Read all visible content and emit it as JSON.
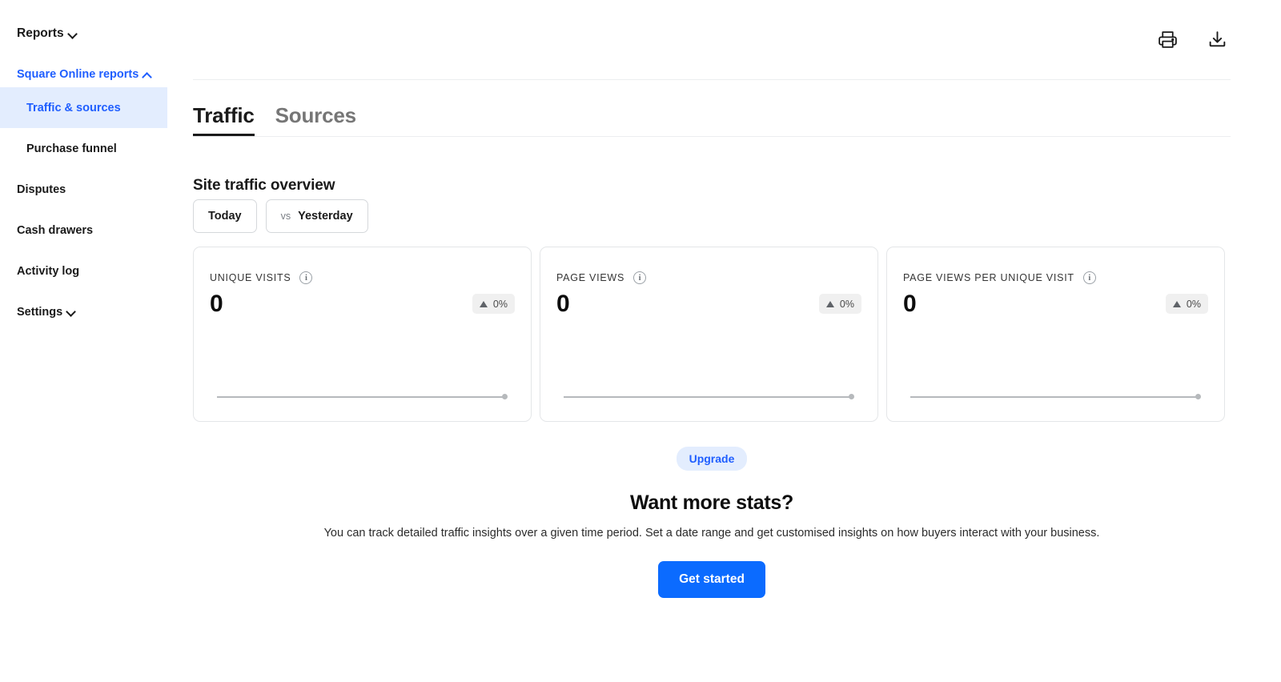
{
  "sidebar": {
    "top": {
      "label": "Reports",
      "icon": "chevron-down-icon"
    },
    "group": {
      "label": "Square Online reports",
      "icon": "chevron-up-icon"
    },
    "sub_items": [
      {
        "label": "Traffic & sources",
        "active": true
      },
      {
        "label": "Purchase funnel",
        "active": false
      }
    ],
    "items": [
      {
        "label": "Disputes",
        "has_chevron": false
      },
      {
        "label": "Cash drawers",
        "has_chevron": false
      },
      {
        "label": "Activity log",
        "has_chevron": false
      },
      {
        "label": "Settings",
        "has_chevron": true
      }
    ]
  },
  "topbar": {
    "print_icon": "printer-icon",
    "download_icon": "download-icon"
  },
  "tabs": [
    {
      "label": "Traffic",
      "active": true
    },
    {
      "label": "Sources",
      "active": false
    }
  ],
  "overview": {
    "title": "Site traffic overview",
    "range_primary": "Today",
    "range_vs_prefix": "vs",
    "range_compare": "Yesterday"
  },
  "cards": [
    {
      "label": "UNIQUE VISITS",
      "value": "0",
      "delta": "0%",
      "delta_direction": "up",
      "info_icon": "info-icon"
    },
    {
      "label": "PAGE VIEWS",
      "value": "0",
      "delta": "0%",
      "delta_direction": "up",
      "info_icon": "info-icon"
    },
    {
      "label": "PAGE VIEWS PER UNIQUE VISIT",
      "value": "0",
      "delta": "0%",
      "delta_direction": "up",
      "info_icon": "info-icon"
    }
  ],
  "promo": {
    "badge": "Upgrade",
    "title": "Want more stats?",
    "description": "You can track detailed traffic insights over a given time period. Set a date range and get customised insights on how buyers interact with your business.",
    "cta": "Get started"
  },
  "colors": {
    "brand_blue": "#1f5eff",
    "cta_blue": "#0b6bff",
    "badge_bg": "#e3edfe",
    "active_nav_bg": "#e3edfe",
    "card_border": "#e4e6e8",
    "delta_bg": "#f0f0f0",
    "spark_gray": "#b6b9bc"
  }
}
